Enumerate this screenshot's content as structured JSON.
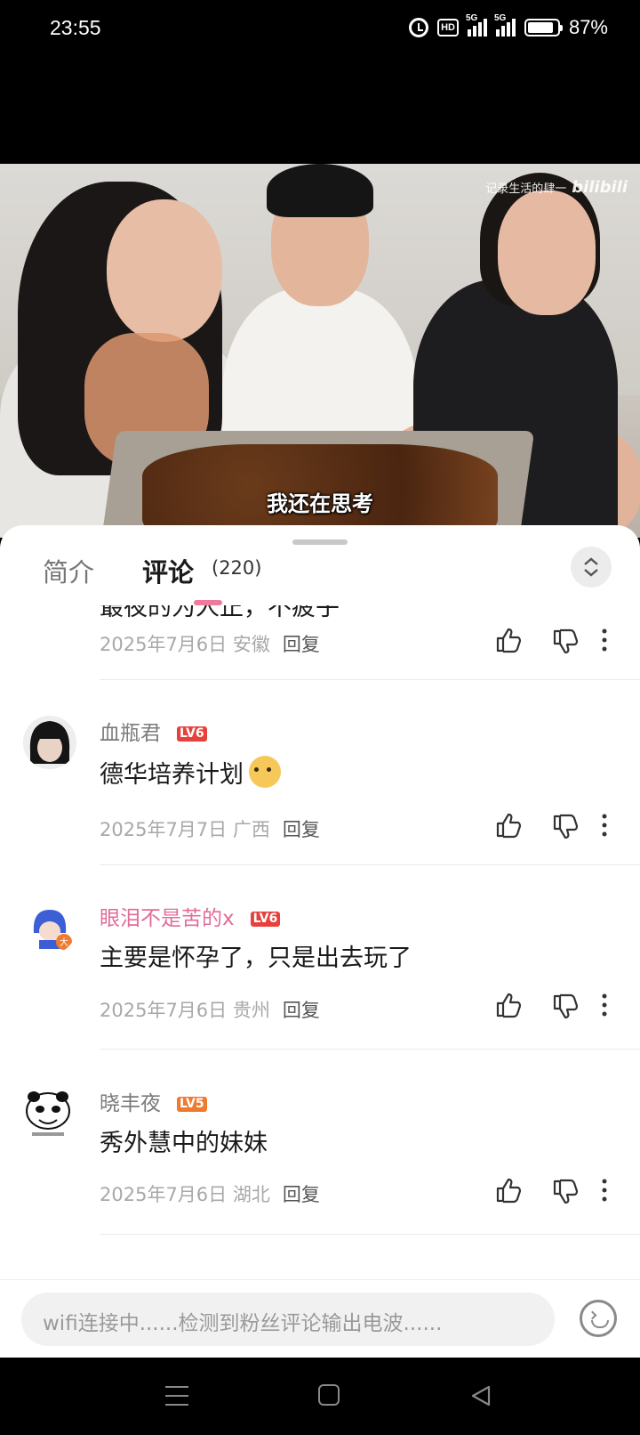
{
  "status_bar": {
    "time": "23:55",
    "hd_label": "HD",
    "net1": "5G",
    "net2": "5G",
    "battery": "87%",
    "battery_level": 0.87
  },
  "video": {
    "watermark_text": "记录生活的肆一",
    "watermark_logo": "bilibili",
    "subtitle": "我还在思考"
  },
  "tabs": {
    "intro": "简介",
    "comments": "评论",
    "comments_count": "(220)"
  },
  "comments": [
    {
      "partial_text": "最夜的为人正，不疲乎",
      "date": "2025年7月6日",
      "location": "安徽",
      "reply_label": "回复"
    },
    {
      "username": "血瓶君",
      "level": "LV6",
      "level_color": "#e8403c",
      "text": "德华培养计划",
      "date": "2025年7月7日",
      "location": "广西",
      "reply_label": "回复"
    },
    {
      "username": "眼泪不是苦的x",
      "level": "LV6",
      "level_color": "#e8403c",
      "text": "主要是怀孕了，只是出去玩了",
      "date": "2025年7月6日",
      "location": "贵州",
      "reply_label": "回复"
    },
    {
      "username": "晓丰夜",
      "level": "LV5",
      "level_color": "#f07a2f",
      "text": "秀外慧中的妹妹",
      "date": "2025年7月6日",
      "location": "湖北",
      "reply_label": "回复"
    }
  ],
  "input_bar": {
    "placeholder": "wifi连接中......检测到粉丝评论输出电波......"
  },
  "icons": [
    "alarm-icon",
    "hd-icon",
    "signal-icon",
    "battery-icon",
    "expand-collapse-icon",
    "like-icon",
    "dislike-icon",
    "more-icon",
    "emoji-icon",
    "nav-menu-icon",
    "nav-home-icon",
    "nav-back-icon"
  ]
}
